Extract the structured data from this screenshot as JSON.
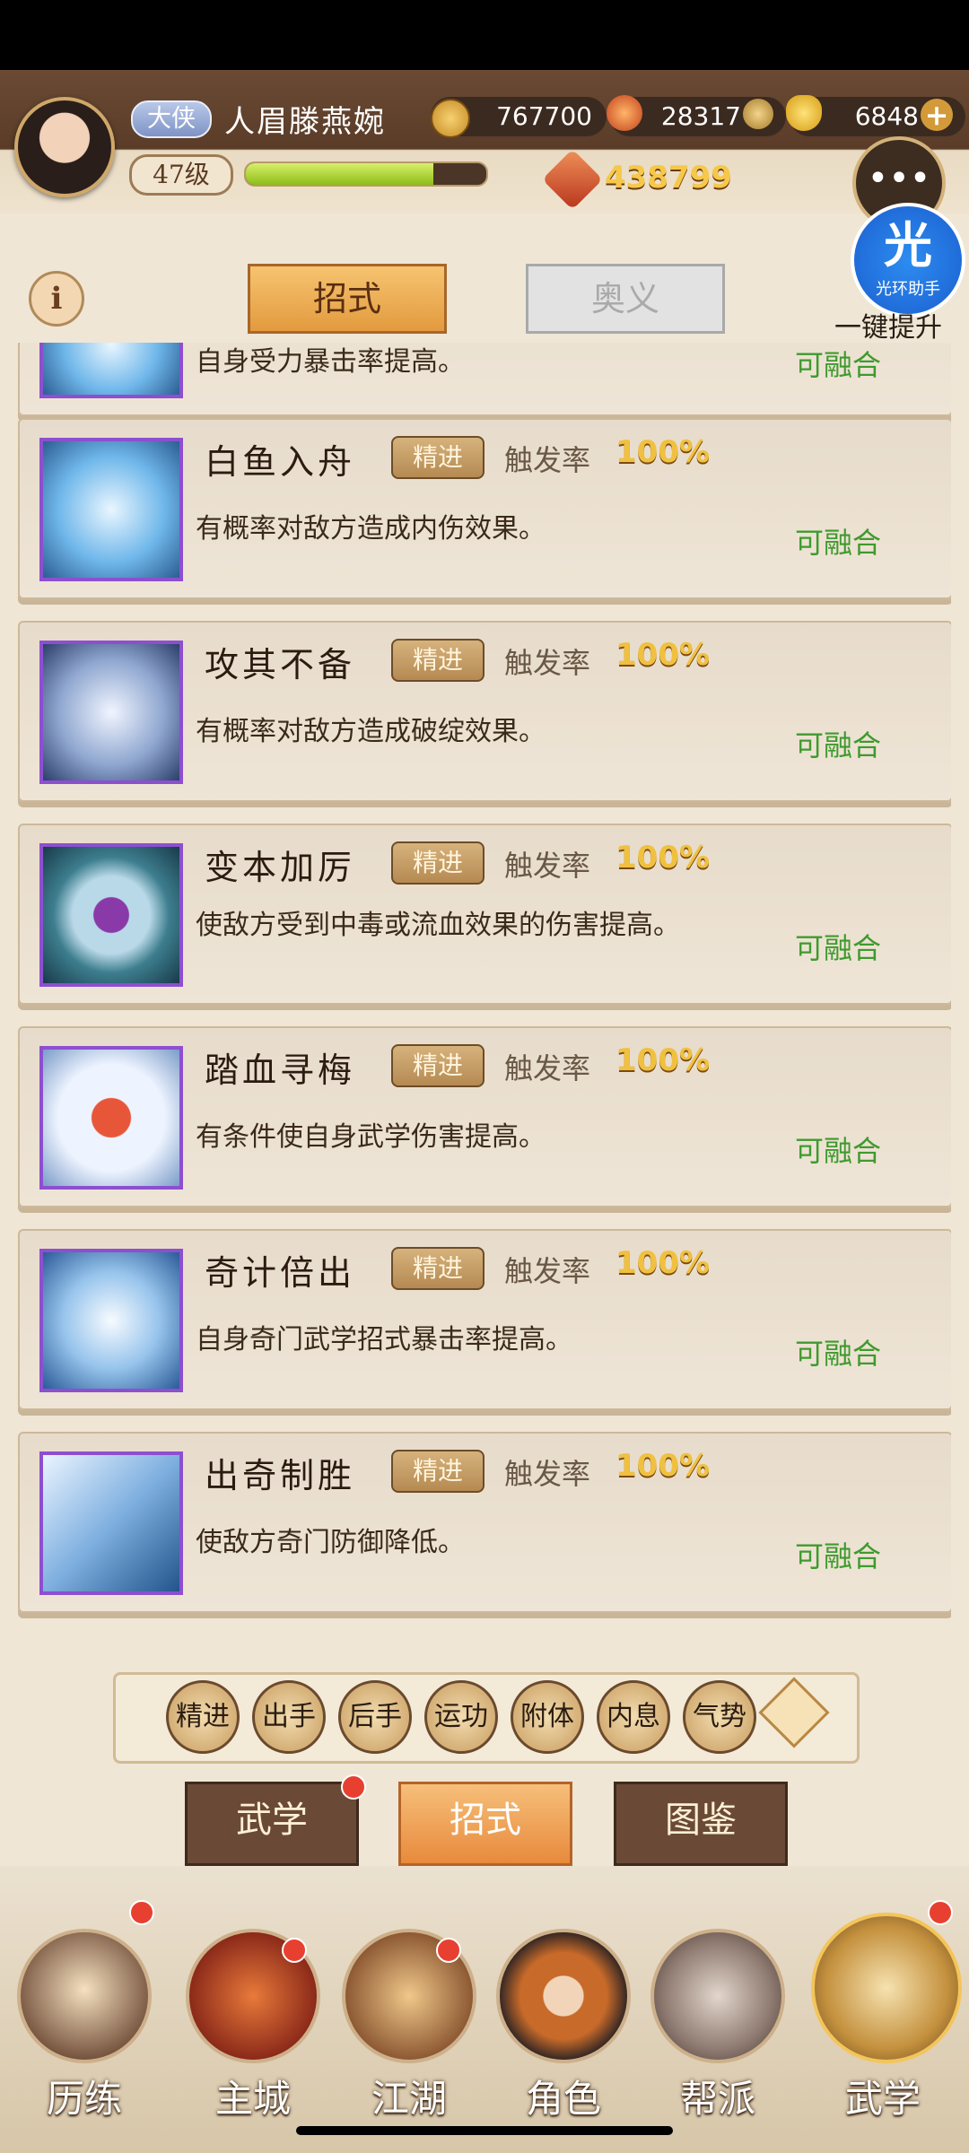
{
  "player": {
    "title": "大侠",
    "name": "人眉滕燕婉",
    "level": "47级",
    "xp_fraction": 0.78,
    "copper": "767700",
    "gems": "28317",
    "gold": "6848",
    "power": "438799"
  },
  "helper": {
    "badge": "光",
    "brand": "光环助手",
    "caption": "一键提升"
  },
  "tabs_top": [
    "招式",
    "奥义"
  ],
  "skills": [
    {
      "name": "白鱼入舟",
      "tag": "精进",
      "rate_label": "触发率",
      "rate": "100%",
      "desc": "有概率对敌方造成内伤效果。",
      "status": "可融合"
    },
    {
      "name": "攻其不备",
      "tag": "精进",
      "rate_label": "触发率",
      "rate": "100%",
      "desc": "有概率对敌方造成破绽效果。",
      "status": "可融合"
    },
    {
      "name": "变本加厉",
      "tag": "精进",
      "rate_label": "触发率",
      "rate": "100%",
      "desc": "使敌方受到中毒或流血效果的伤害提高。",
      "status": "可融合"
    },
    {
      "name": "踏血寻梅",
      "tag": "精进",
      "rate_label": "触发率",
      "rate": "100%",
      "desc": "有条件使自身武学伤害提高。",
      "status": "可融合"
    },
    {
      "name": "奇计倍出",
      "tag": "精进",
      "rate_label": "触发率",
      "rate": "100%",
      "desc": "自身奇门武学招式暴击率提高。",
      "status": "可融合"
    },
    {
      "name": "出奇制胜",
      "tag": "精进",
      "rate_label": "触发率",
      "rate": "100%",
      "desc": "使敌方奇门防御降低。",
      "status": "可融合"
    }
  ],
  "partial_top": {
    "desc": "自身受力暴击率提高。",
    "status": "可融合"
  },
  "filters": [
    "精进",
    "出手",
    "后手",
    "运功",
    "附体",
    "内息",
    "气势"
  ],
  "subtabs": [
    "武学",
    "招式",
    "图鉴"
  ],
  "nav": [
    "历练",
    "主城",
    "江湖",
    "角色",
    "帮派",
    "武学"
  ],
  "icons": {
    "chat": "chat-bubble-icon",
    "info": "info-icon",
    "add": "plus-icon"
  }
}
